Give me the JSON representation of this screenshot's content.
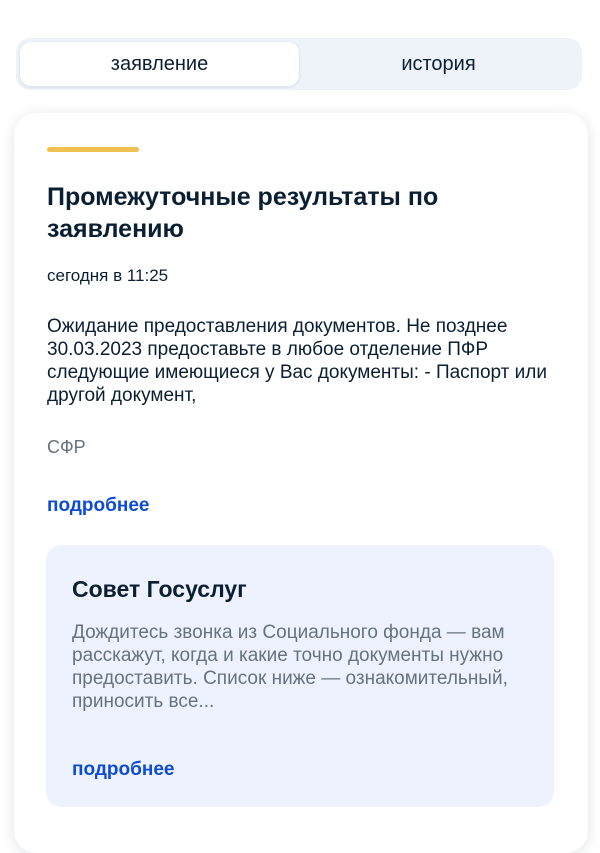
{
  "tabs": {
    "statement": "заявление",
    "history": "история"
  },
  "card": {
    "title": "Промежуточные результаты по заявлению",
    "date": "сегодня в 11:25",
    "body": "Ожидание предоставления документов. Не позднее 30.03.2023 предоставьте в любое отделение ПФР следующие имеющиеся у Вас документы: - Паспорт или другой документ,",
    "source": "СФР",
    "more_label": "подробнее",
    "accent_color": "#f0c150"
  },
  "advice": {
    "title": "Совет Госуслуг",
    "text": "Дождитесь звонка из Социального фонда — вам расскажут, когда и какие точно документы нужно предоставить. Список ниже — ознакомительный, приносить все...",
    "more_label": "подробнее",
    "background_color": "#edf2fe"
  },
  "colors": {
    "link": "#0d4cd3",
    "text": "#0b1f33",
    "secondary_text": "#66727f",
    "tabs_background": "#eef3f9"
  }
}
